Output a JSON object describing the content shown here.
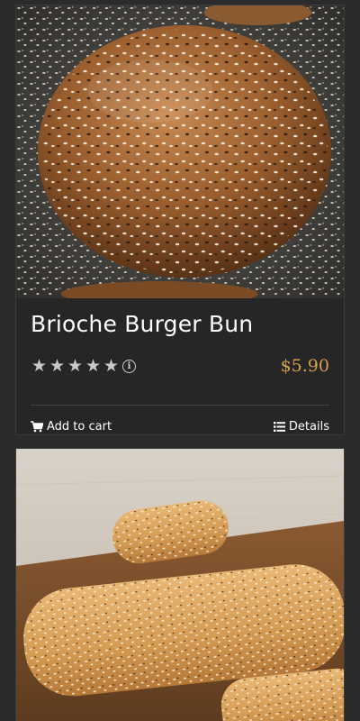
{
  "products": [
    {
      "title": "Brioche Burger Bun",
      "price": "$5.90",
      "rating": 5,
      "rating_max": 5,
      "info_icon": "info-icon",
      "add_to_cart_label": "Add to cart",
      "details_label": "Details"
    },
    {
      "title": "",
      "price": ""
    }
  ],
  "colors": {
    "background": "#2b2b2b",
    "card": "#262626",
    "price": "#d6a04e",
    "text": "#ffffff",
    "stars": "#c9c9c9"
  },
  "icons": {
    "cart": "cart-icon",
    "details": "list-icon",
    "star": "star-icon"
  }
}
